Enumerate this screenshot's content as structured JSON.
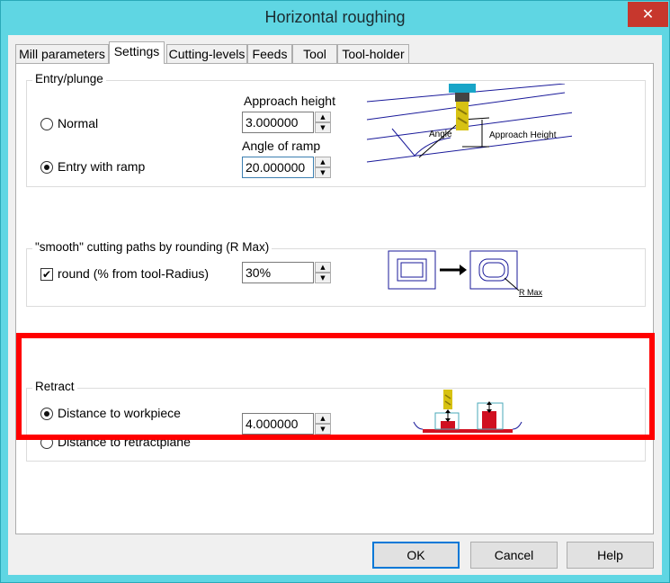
{
  "window": {
    "title": "Horizontal roughing",
    "close_glyph": "✕"
  },
  "tabs": [
    {
      "label": "Mill parameters",
      "active": false
    },
    {
      "label": "Settings",
      "active": true
    },
    {
      "label": "Cutting-levels",
      "active": false
    },
    {
      "label": "Feeds",
      "active": false
    },
    {
      "label": "Tool",
      "active": false
    },
    {
      "label": "Tool-holder",
      "active": false
    }
  ],
  "entry": {
    "legend": "Entry/plunge",
    "normal_label": "Normal",
    "ramp_label": "Entry with ramp",
    "selected": "ramp",
    "approach_height_label": "Approach height",
    "approach_height_value": "3.000000",
    "angle_label": "Angle of ramp",
    "angle_value": "20.000000",
    "diagram": {
      "angle_text": "Angle",
      "height_text": "Approach Height"
    }
  },
  "smooth": {
    "legend": "\"smooth\" cutting paths by rounding (R Max)",
    "round_label": "round (% from tool-Radius)",
    "round_checked": true,
    "round_value": "30%",
    "diagram": {
      "rmax_text": "R Max"
    }
  },
  "retract": {
    "legend": "Retract",
    "workpiece_label": "Distance to workpiece",
    "retractplane_label": "Distance to retractplane",
    "selected": "workpiece",
    "distance_value": "4.000000",
    "highlight_color": "#ff0000"
  },
  "buttons": {
    "ok": "OK",
    "cancel": "Cancel",
    "help": "Help"
  },
  "spinner": {
    "up_glyph": "▲",
    "down_glyph": "▼"
  },
  "checkmark": "✔"
}
